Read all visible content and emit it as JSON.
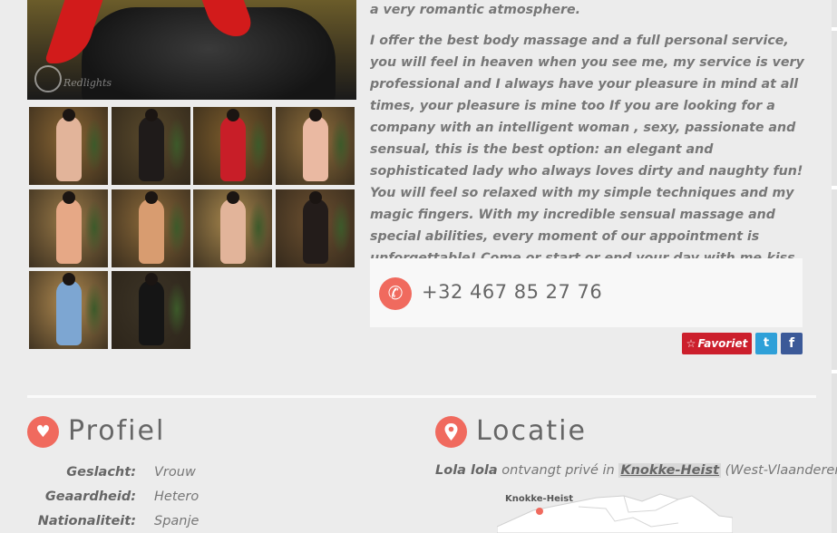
{
  "main_photo": {
    "watermark": "Redlights"
  },
  "gallery": {
    "thumbs": [
      {
        "tone": "#8a6634",
        "figure": "#e2b49a"
      },
      {
        "tone": "#5a4a2c",
        "figure": "#1f1b1a"
      },
      {
        "tone": "#7d5d2c",
        "figure": "#c81e28"
      },
      {
        "tone": "#8e6e3c",
        "figure": "#eab9a2"
      },
      {
        "tone": "#9a7a48",
        "figure": "#e6a886"
      },
      {
        "tone": "#8c6a3a",
        "figure": "#d89c70"
      },
      {
        "tone": "#a8884e",
        "figure": "#e2b49a"
      },
      {
        "tone": "#6c5030",
        "figure": "#231c1a"
      },
      {
        "tone": "#b08a50",
        "figure": "#7da6d2"
      },
      {
        "tone": "#3c3426",
        "figure": "#151515"
      }
    ]
  },
  "description": {
    "lead": "a very romantic atmosphere.",
    "body": "I offer the best body massage and a full personal service, you will feel in heaven when you see me, my service is very professional and I always have your pleasure in mind at all times, your pleasure is mine too If you are looking for a company with an intelligent woman , sexy, passionate and sensual, this is the best option: an elegant and sophisticated lady who always loves dirty and naughty fun! You will feel so relaxed with my simple techniques and my magic fingers. With my incredible sensual massage and special abilities, every moment of our appointment is unforgettable! Come or start or end your day with me.kiss love 😍😍😘"
  },
  "contact": {
    "phone": "+32 467 85 27 76",
    "phone_icon": "phone-icon"
  },
  "actions": {
    "favorite_label": "Favoriet",
    "twitter_label": "t",
    "facebook_label": "f"
  },
  "profile": {
    "title": "Profiel",
    "icon": "heart-icon",
    "rows": [
      {
        "label": "Geslacht:",
        "value": "Vrouw"
      },
      {
        "label": "Geaardheid:",
        "value": "Hetero"
      },
      {
        "label": "Nationaliteit:",
        "value": "Spanje"
      }
    ]
  },
  "location": {
    "title": "Locatie",
    "icon": "map-pin-icon",
    "name": "Lola lola",
    "text_mid": " ontvangt privé in ",
    "city": "Knokke-Heist",
    "region": " (West-Vlaanderen)",
    "map_label": "Knokke-Heist"
  },
  "colors": {
    "accent": "#f06a5e",
    "favorite": "#cc1f2c",
    "twitter": "#2fa0d8",
    "facebook": "#3b5998"
  }
}
